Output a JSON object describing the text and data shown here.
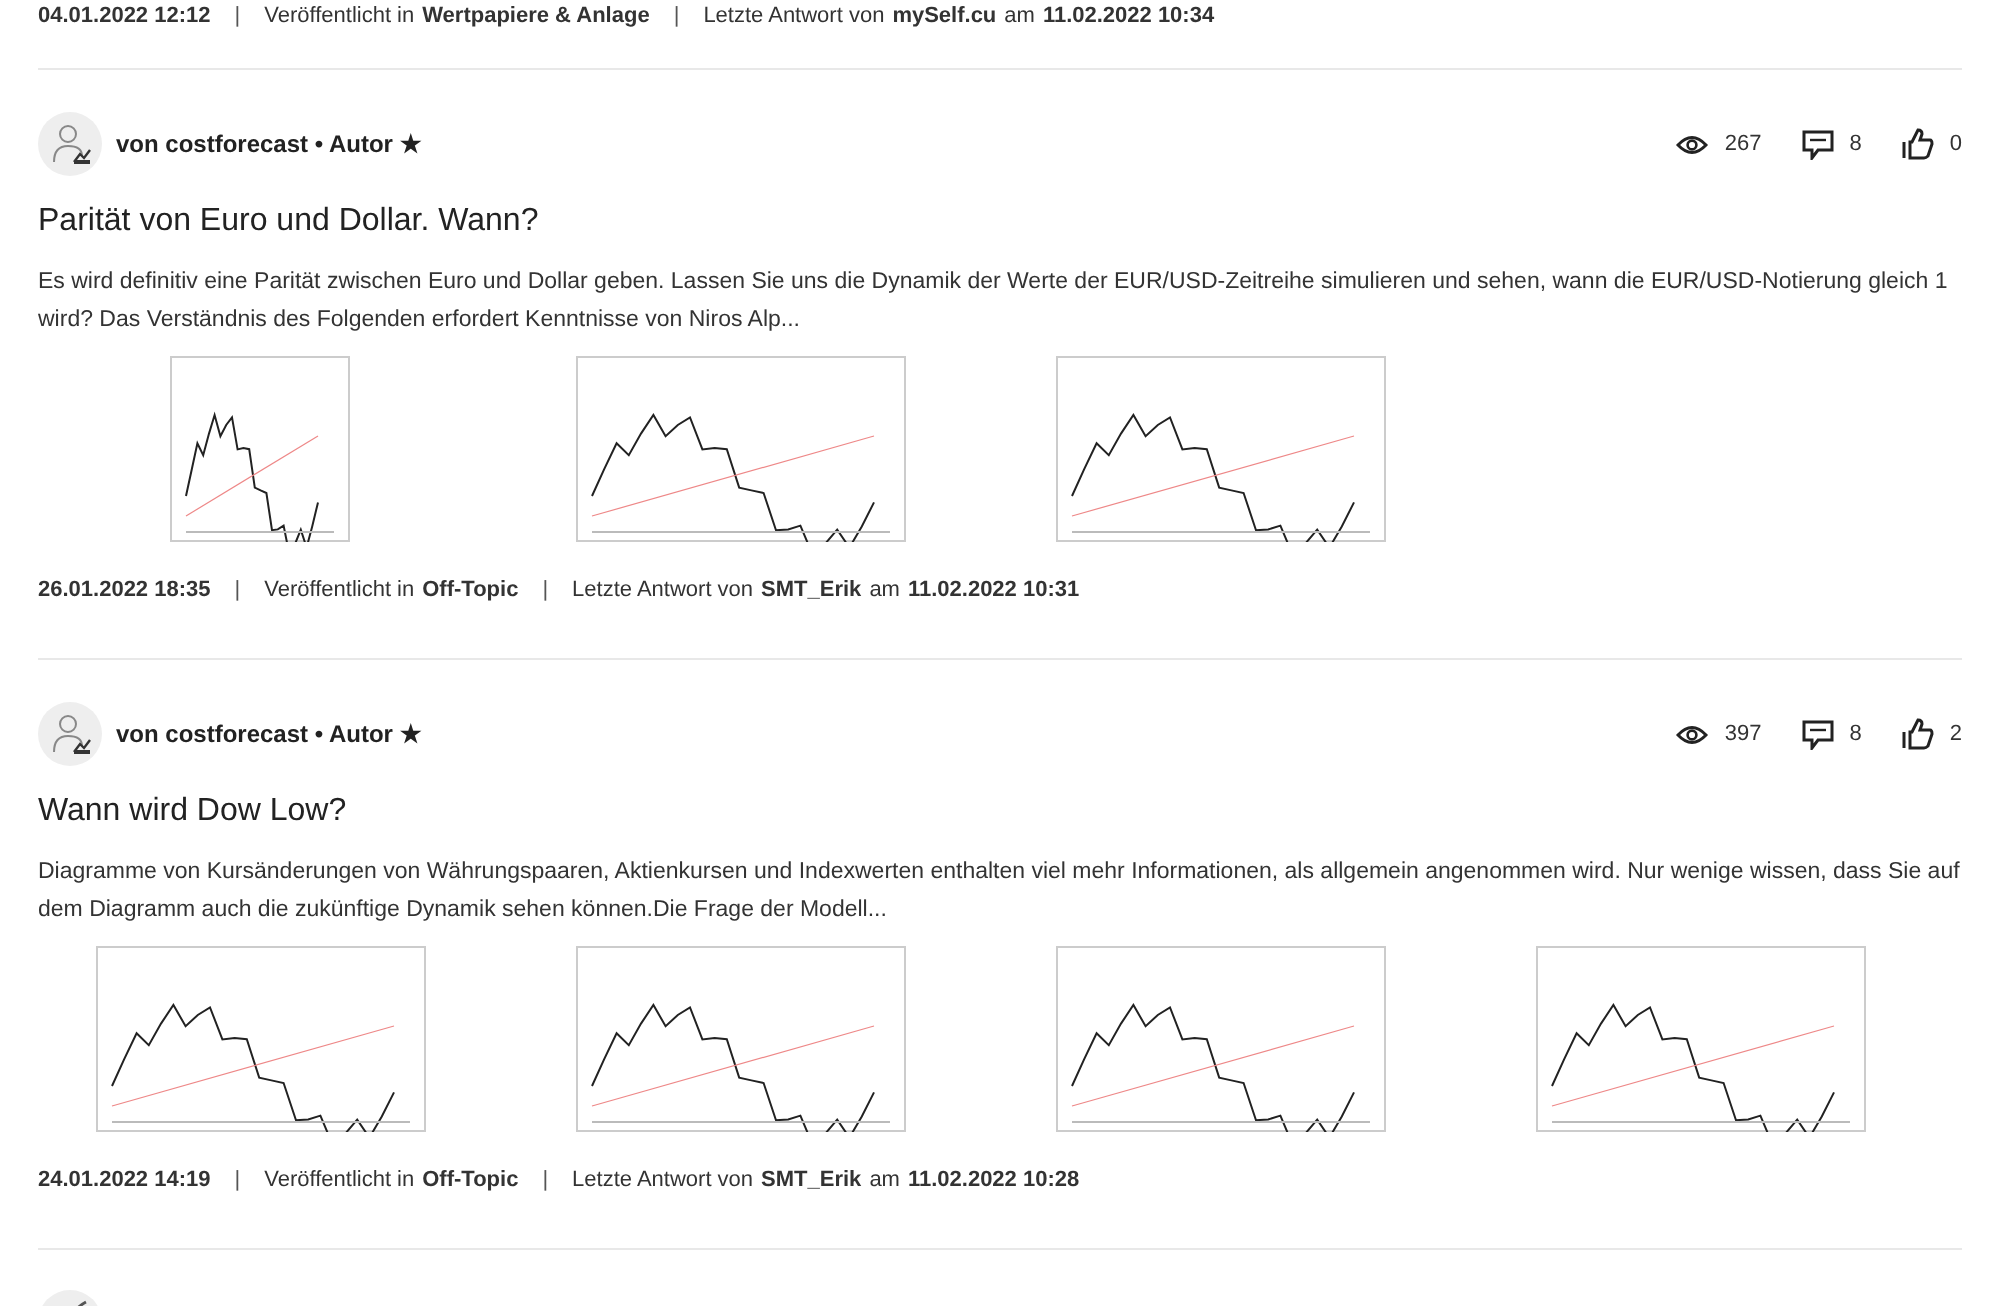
{
  "top_meta": {
    "date": "04.01.2022 12:12",
    "separator": "|",
    "published_label": "Veröffentlicht in",
    "category": "Wertpapiere & Anlage",
    "reply_label": "Letzte Antwort von",
    "reply_user": "mySelf.cu",
    "at_label": "am",
    "reply_date": "11.02.2022 10:34"
  },
  "posts": [
    {
      "author_line": "von costforecast • Autor ★",
      "views": "267",
      "comments": "8",
      "likes": "0",
      "title": "Parität von Euro und Dollar. Wann?",
      "excerpt": "Es wird definitiv eine Parität zwischen Euro und Dollar geben. Lassen Sie uns die Dynamik der Werte der EUR/USD-Zeitreihe simulieren und sehen, wann die EUR/USD-Notierung gleich 1 wird? Das Verständnis des Folgenden erfordert Kenntnisse von Niros Alp...",
      "images": [
        {
          "kind": "narrow"
        },
        {
          "kind": "wide"
        },
        {
          "kind": "wide"
        }
      ],
      "meta": {
        "date": "26.01.2022 18:35",
        "separator": "|",
        "published_label": "Veröffentlicht in",
        "category": "Off-Topic",
        "reply_label": "Letzte Antwort von",
        "reply_user": "SMT_Erik",
        "at_label": "am",
        "reply_date": "11.02.2022 10:31"
      }
    },
    {
      "author_line": "von costforecast • Autor ★",
      "views": "397",
      "comments": "8",
      "likes": "2",
      "title": "Wann wird Dow Low?",
      "excerpt": "Diagramme von Kursänderungen von Währungspaaren, Aktienkursen und Indexwerten enthalten viel mehr Informationen, als allgemein angenommen wird. Nur wenige wissen, dass Sie auf dem Diagramm auch die zukünftige Dynamik sehen können.Die Frage der Modell...",
      "images": [
        {
          "kind": "wide"
        },
        {
          "kind": "wide"
        },
        {
          "kind": "wide"
        },
        {
          "kind": "wide"
        }
      ],
      "meta": {
        "date": "24.01.2022 14:19",
        "separator": "|",
        "published_label": "Veröffentlicht in",
        "category": "Off-Topic",
        "reply_label": "Letzte Antwort von",
        "reply_user": "SMT_Erik",
        "at_label": "am",
        "reply_date": "11.02.2022 10:28"
      }
    }
  ]
}
